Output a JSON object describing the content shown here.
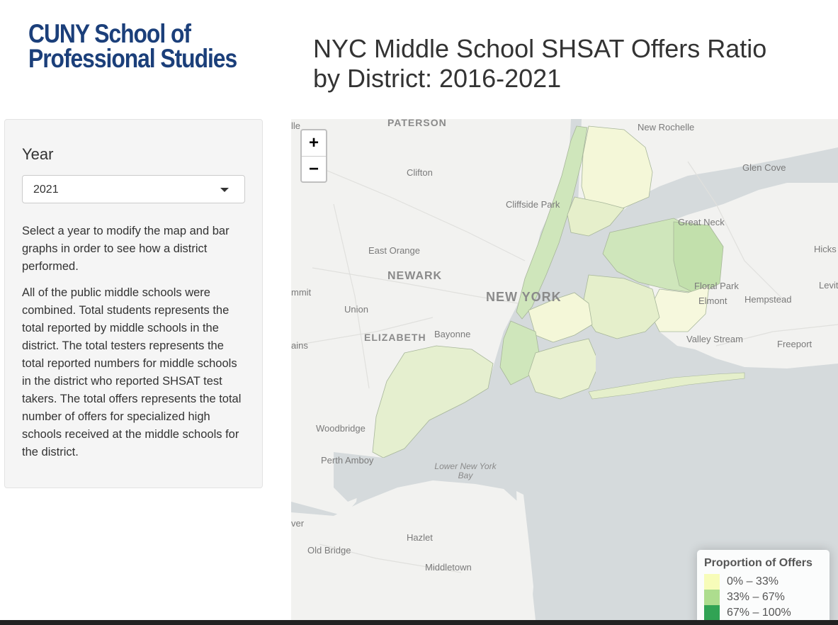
{
  "header": {
    "logo_line1": "CUNY School of",
    "logo_line2": "Professional Studies",
    "title_line1": "NYC Middle School SHSAT Offers Ratio",
    "title_line2": "by District: 2016-2021"
  },
  "sidebar": {
    "year_label": "Year",
    "year_selected": "2021",
    "paragraph1": "Select a year to modify the map and bar graphs in order to see how a district performed.",
    "paragraph2": "All of the public middle schools were combined. Total students represents the total reported by middle schools in the district. The total testers represents the total reported numbers for middle schools in the district who reported SHSAT test takers. The total offers represents the total number of offers for specialized high schools received at the middle schools for the district."
  },
  "map": {
    "zoom_in_label": "+",
    "zoom_out_label": "−",
    "place_labels": {
      "paterson": "PATERSON",
      "new_rochelle": "New Rochelle",
      "clifton": "Clifton",
      "glen_cove": "Glen Cove",
      "cliffside_park": "Cliffside Park",
      "great_neck": "Great Neck",
      "east_orange": "East Orange",
      "hicks": "Hicks",
      "newark": "NEWARK",
      "floral_park": "Floral Park",
      "levit": "Levit",
      "summit": "mmit",
      "union": "Union",
      "new_york": "NEW YORK",
      "elmont": "Elmont",
      "hempstead": "Hempstead",
      "elizabeth": "ELIZABETH",
      "bayonne": "Bayonne",
      "valley_stream": "Valley Stream",
      "freeport": "Freeport",
      "plains": "ains",
      "woodbridge": "Woodbridge",
      "perth_amboy": "Perth Amboy",
      "lower_ny_bay_line1": "Lower New York",
      "lower_ny_bay_line2": "Bay",
      "river": "ver",
      "hazlet": "Hazlet",
      "old_bridge": "Old Bridge",
      "middletown": "Middletown",
      "lle": "lle"
    },
    "legend": {
      "title": "Proportion of Offers",
      "items": [
        {
          "label": "0% – 33%",
          "color": "#f7fcb9"
        },
        {
          "label": "33% – 67%",
          "color": "#addd8e"
        },
        {
          "label": "67% – 100%",
          "color": "#31a354"
        }
      ]
    },
    "colors": {
      "water": "#d5dadc",
      "land": "#f2f2f0",
      "district_low": "#f7fcb9",
      "district_mid": "#addd8e",
      "district_high": "#31a354",
      "district_border": "#a7b69a"
    }
  }
}
